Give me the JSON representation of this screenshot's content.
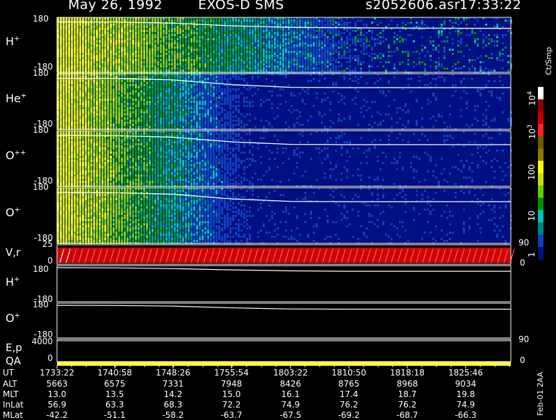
{
  "header": {
    "date": "May 26, 1992",
    "instrument": "EXOS-D SMS",
    "file": "s2052606.asr",
    "time": "17:33:22"
  },
  "colorbar": {
    "unit": "Ct/Smp",
    "ticks": [
      "10",
      "10",
      "100",
      "10",
      "1"
    ],
    "tick_sups": [
      "4",
      "3",
      "",
      "",
      ""
    ],
    "colors": [
      "#ffffff",
      "#8b0000",
      "#c00000",
      "#ff2020",
      "#6b5a00",
      "#8b7800",
      "#ffff00",
      "#c8e000",
      "#66cc00",
      "#009000",
      "#00c0c0",
      "#008080",
      "#1040c0",
      "#001080"
    ]
  },
  "version": "Feb-01 2AA",
  "chart_data": {
    "type": "heatmap",
    "title": "May 26, 1992 EXOS-D SMS",
    "panels": [
      {
        "name": "H+",
        "ylim": [
          -180,
          180
        ],
        "yticks": [
          "180",
          "-180"
        ],
        "angle_trace": [
          150,
          150,
          142,
          125,
          115,
          112,
          110,
          108
        ]
      },
      {
        "name": "He+",
        "ylim": [
          -180,
          180
        ],
        "yticks": [
          "180",
          "-180"
        ],
        "angle_trace": [
          150,
          150,
          140,
          110,
          92,
          90,
          90,
          90
        ]
      },
      {
        "name": "O++",
        "ylim": [
          -180,
          180
        ],
        "yticks": [
          "180",
          "-180"
        ],
        "angle_trace": [
          150,
          148,
          138,
          108,
          92,
          90,
          90,
          90
        ]
      },
      {
        "name": "O+",
        "ylim": [
          -180,
          180
        ],
        "yticks": [
          "180",
          "-180"
        ],
        "angle_trace": [
          150,
          148,
          138,
          108,
          92,
          90,
          90,
          90
        ]
      },
      {
        "name": "V,r",
        "ylim": [
          0,
          25
        ],
        "yticks": [
          "25",
          "0"
        ],
        "right_ticks": [
          "90",
          "0"
        ]
      },
      {
        "name": "H+",
        "ylim": [
          -180,
          180
        ],
        "yticks": [
          "180",
          "-180"
        ],
        "angle_trace": [
          160,
          158,
          150,
          138,
          128,
          124,
          124,
          124
        ]
      },
      {
        "name": "O+",
        "ylim": [
          -180,
          180
        ],
        "yticks": [
          "180",
          "-180"
        ],
        "angle_trace": [
          158,
          156,
          150,
          132,
          120,
          118,
          118,
          118
        ]
      },
      {
        "name": "E,p",
        "ylim": [
          0,
          4000
        ],
        "yticks": [
          "4000",
          "0"
        ],
        "right_ticks": [
          "90"
        ]
      },
      {
        "name": "QA",
        "yticks": [
          "0"
        ],
        "right_ticks": [
          "0"
        ]
      }
    ],
    "axis_table": {
      "rows": [
        {
          "label": "UT",
          "values": [
            "1733:22",
            "1740:58",
            "1748:26",
            "1755:54",
            "1803:22",
            "1810:50",
            "1818:18",
            "1825:46"
          ]
        },
        {
          "label": "ALT",
          "values": [
            "5663",
            "6575",
            "7331",
            "7948",
            "8426",
            "8765",
            "8968",
            "9034"
          ]
        },
        {
          "label": "MLT",
          "values": [
            "13.0",
            "13.5",
            "14.2",
            "15.0",
            "16.1",
            "17.4",
            "18.7",
            "19.8"
          ]
        },
        {
          "label": "InLat",
          "values": [
            "56.9",
            "63.3",
            "68.3",
            "72.2",
            "74.9",
            "76.2",
            "76.2",
            "74.9"
          ]
        },
        {
          "label": "MLat",
          "values": [
            "-42.2",
            "-51.1",
            "-58.2",
            "-63.7",
            "-67.5",
            "-69.2",
            "-68.7",
            "-66.3"
          ]
        }
      ]
    }
  }
}
